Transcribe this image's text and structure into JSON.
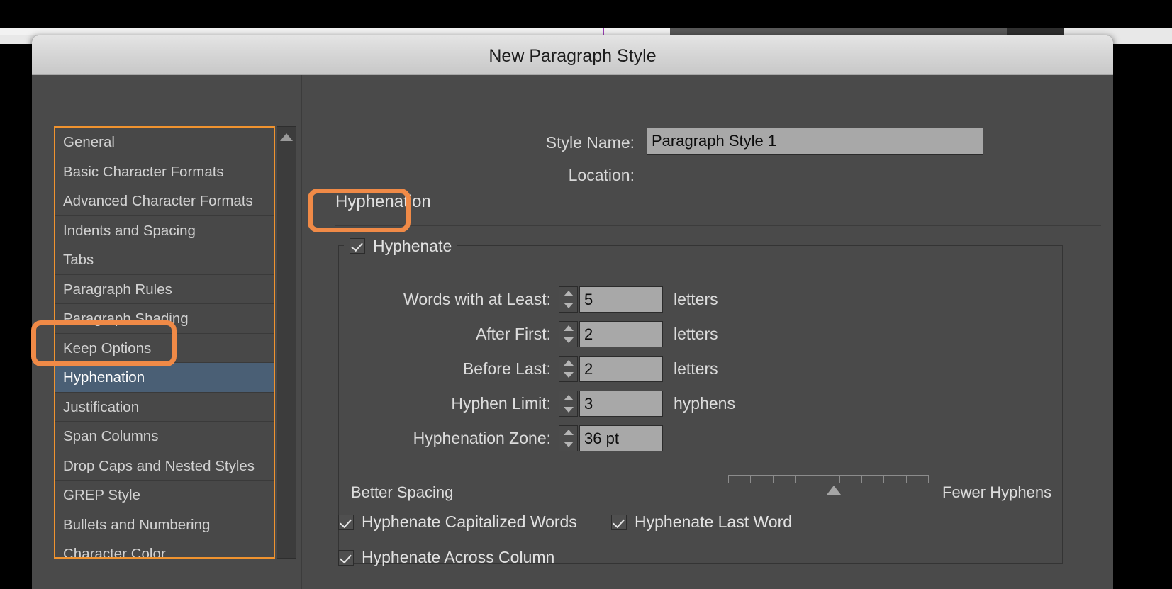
{
  "dialog": {
    "title": "New Paragraph Style",
    "style_name_label": "Style Name:",
    "style_name_value": "Paragraph Style 1",
    "location_label": "Location:",
    "location_value": "",
    "section_title": "Hyphenation"
  },
  "sidebar": {
    "items": [
      {
        "label": "General",
        "selected": false
      },
      {
        "label": "Basic Character Formats",
        "selected": false
      },
      {
        "label": "Advanced Character Formats",
        "selected": false
      },
      {
        "label": "Indents and Spacing",
        "selected": false
      },
      {
        "label": "Tabs",
        "selected": false
      },
      {
        "label": "Paragraph Rules",
        "selected": false
      },
      {
        "label": "Paragraph Shading",
        "selected": false
      },
      {
        "label": "Keep Options",
        "selected": false
      },
      {
        "label": "Hyphenation",
        "selected": true
      },
      {
        "label": "Justification",
        "selected": false
      },
      {
        "label": "Span Columns",
        "selected": false
      },
      {
        "label": "Drop Caps and Nested Styles",
        "selected": false
      },
      {
        "label": "GREP Style",
        "selected": false
      },
      {
        "label": "Bullets and Numbering",
        "selected": false
      },
      {
        "label": "Character Color",
        "selected": false
      }
    ]
  },
  "hyphenation": {
    "enable_label": "Hyphenate",
    "enable_checked": true,
    "fields": [
      {
        "label": "Words with at Least:",
        "value": "5",
        "unit": "letters"
      },
      {
        "label": "After First:",
        "value": "2",
        "unit": "letters"
      },
      {
        "label": "Before Last:",
        "value": "2",
        "unit": "letters"
      },
      {
        "label": "Hyphen Limit:",
        "value": "3",
        "unit": "hyphens"
      },
      {
        "label": "Hyphenation Zone:",
        "value": "36 pt",
        "unit": ""
      }
    ],
    "slider": {
      "left_label": "Better Spacing",
      "right_label": "Fewer Hyphens",
      "ticks": 10,
      "position_percent": 50
    },
    "options": [
      {
        "label": "Hyphenate Capitalized Words",
        "checked": true
      },
      {
        "label": "Hyphenate Last Word",
        "checked": true
      },
      {
        "label": "Hyphenate Across Column",
        "checked": true
      }
    ]
  },
  "colors": {
    "annotation": "#f08a47",
    "selection": "#4a5f75",
    "panel_background": "#4a4a4a",
    "input_background": "#a8a8a8"
  }
}
